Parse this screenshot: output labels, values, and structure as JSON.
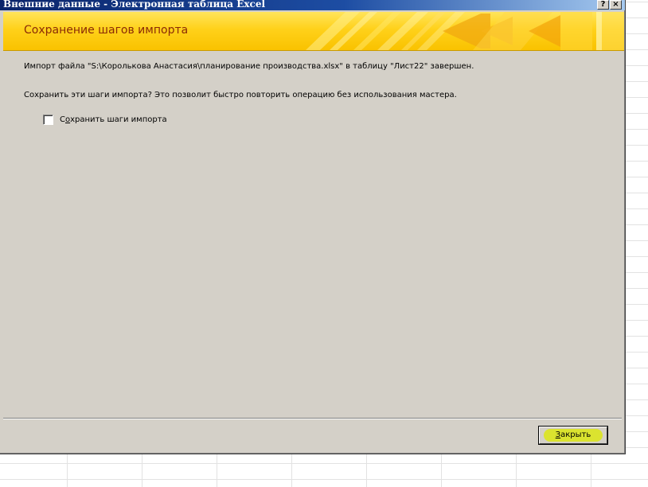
{
  "window": {
    "title": "Внешние данные - Электронная таблица Excel",
    "help_button": "?",
    "close_button": "×"
  },
  "header": {
    "title": "Сохранение шагов импорта"
  },
  "body": {
    "import_message": "Импорт файла \"S:\\Королькова Анастасия\\планирование производства.xlsx\" в таблицу \"Лист22\" завершен.",
    "save_question": "Сохранить эти шаги импорта? Это позволит быстро повторить операцию без использования мастера.",
    "save_steps_checkbox": {
      "label_prefix": "С",
      "label_accel": "о",
      "label_rest": "хранить шаги импорта",
      "checked": false
    }
  },
  "footer": {
    "close_accel": "З",
    "close_rest": "акрыть"
  },
  "colors": {
    "title_bar_start": "#0a246a",
    "title_bar_end": "#a6caf0",
    "banner_yellow": "#ffd11a",
    "banner_text": "#8a2a06",
    "dialog_face": "#d4d0c8",
    "button_highlight": "#dce614"
  }
}
